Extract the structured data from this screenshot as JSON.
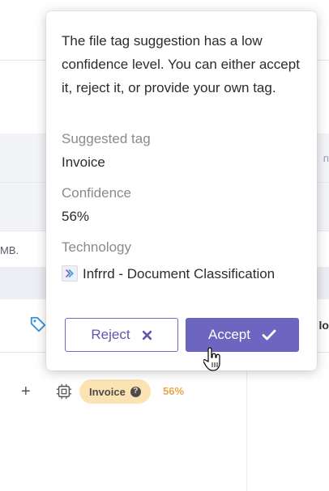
{
  "background": {
    "column_header": "MB.",
    "right_header_fragment": "lo",
    "right_top_fragment": "n",
    "row": {
      "add_symbol": "+",
      "tag_label": "Invoice",
      "tag_help_symbol": "?",
      "confidence": "56%"
    }
  },
  "popover": {
    "message": "The file tag suggestion has a low confidence level. You can either accept it, reject it, or provide your own tag.",
    "suggested_tag_label": "Suggested tag",
    "suggested_tag_value": "Invoice",
    "confidence_label": "Confidence",
    "confidence_value": "56%",
    "technology_label": "Technology",
    "technology_value": "Infrrd - Document Classification",
    "reject_label": "Reject",
    "accept_label": "Accept"
  },
  "colors": {
    "accent": "#6c66c0",
    "tag_pill_bg": "#fce3b4",
    "confidence_orange": "#e8a54a"
  }
}
